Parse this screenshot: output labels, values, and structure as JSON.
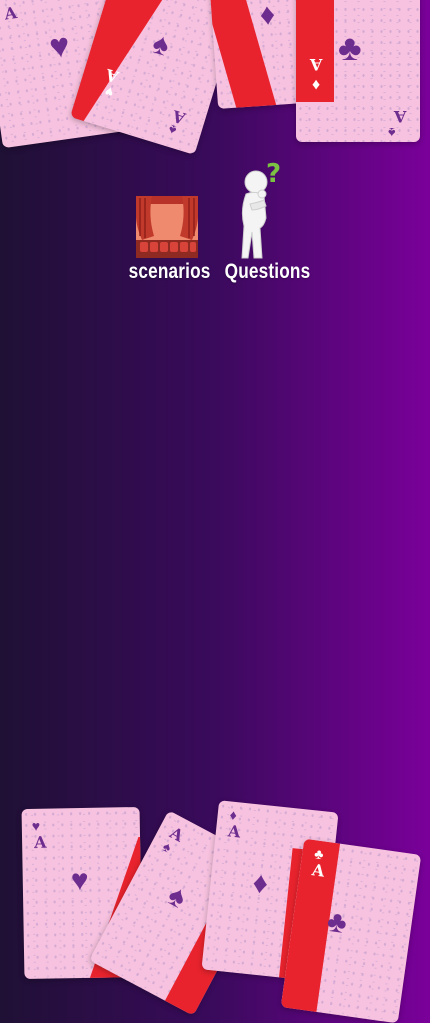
{
  "menu": {
    "items": [
      {
        "id": "scenarios",
        "label": "scenarios",
        "icon": "theater-stage-icon"
      },
      {
        "id": "questions",
        "label": "Questions",
        "icon": "thinking-person-icon"
      }
    ]
  },
  "cards": {
    "rank": "A",
    "suits": [
      "♥",
      "♠",
      "♦",
      "♣"
    ]
  },
  "colors": {
    "card": "#f7c2df",
    "stripe": "#e8232d",
    "ink": "#6d2d8f",
    "accent_question": "#7cc242"
  }
}
